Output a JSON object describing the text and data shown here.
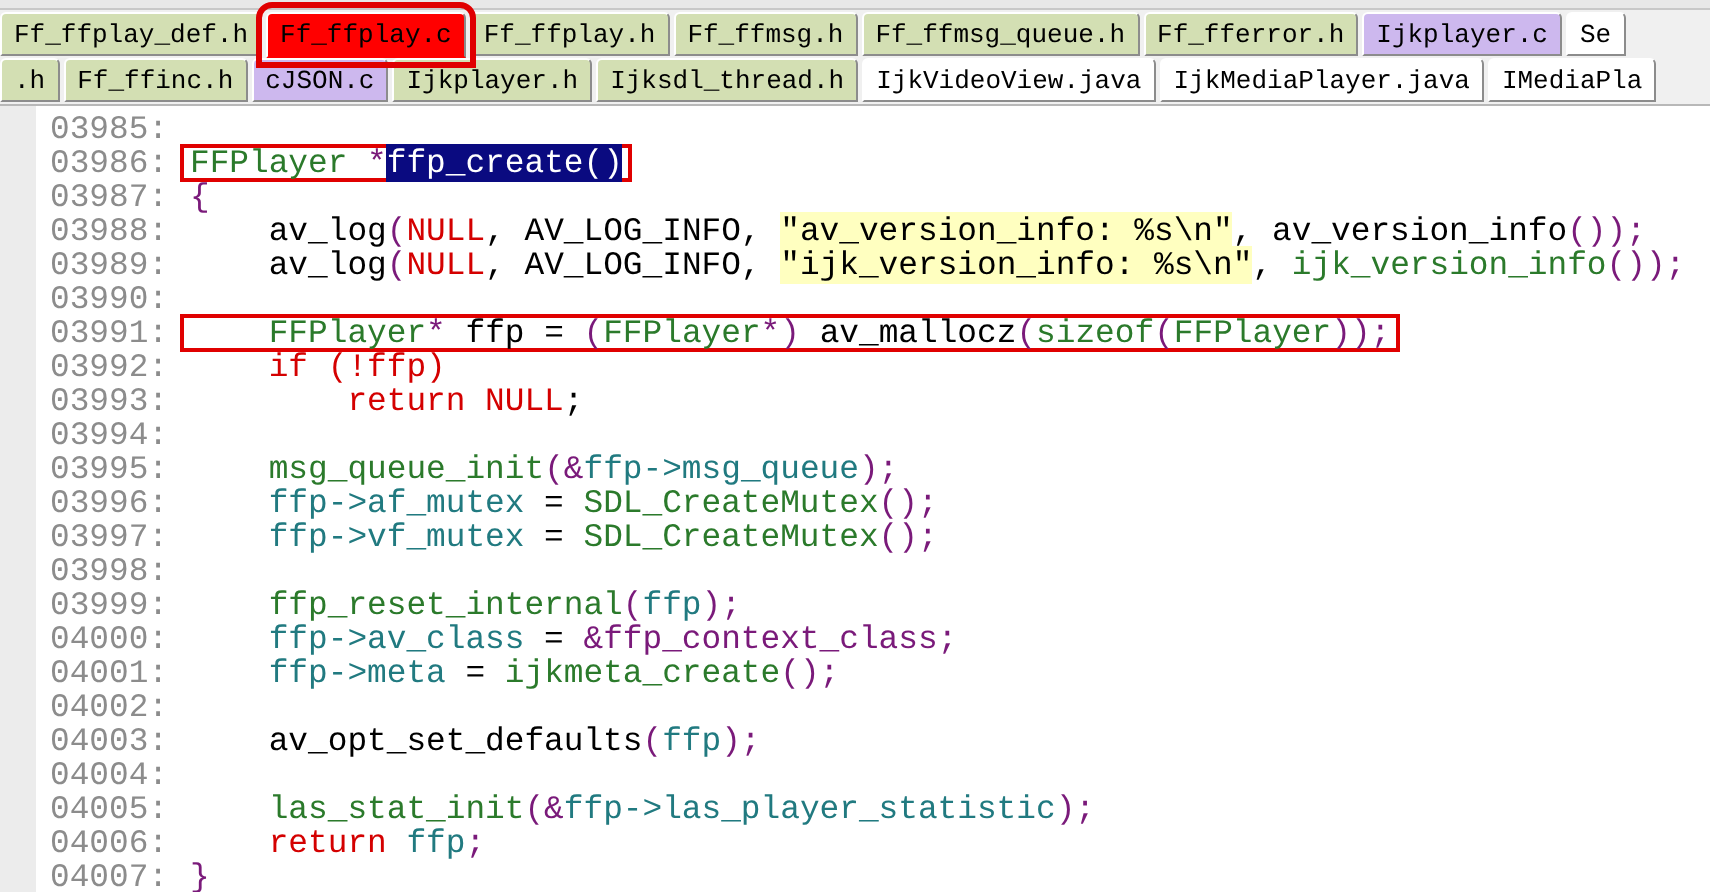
{
  "tab_rows": [
    {
      "tabs": [
        {
          "label": "Ff_ffplay_def.h",
          "color": "#d3dfb3",
          "selected": false,
          "annotated": false
        },
        {
          "label": "Ff_ffplay.c",
          "color": "#ff0000",
          "selected": true,
          "annotated": true
        },
        {
          "label": "Ff_ffplay.h",
          "color": "#d3dfb3",
          "selected": false,
          "annotated": false
        },
        {
          "label": "Ff_ffmsg.h",
          "color": "#d3dfb3",
          "selected": false,
          "annotated": false
        },
        {
          "label": "Ff_ffmsg_queue.h",
          "color": "#d3dfb3",
          "selected": false,
          "annotated": false
        },
        {
          "label": "Ff_fferror.h",
          "color": "#d3dfb3",
          "selected": false,
          "annotated": false
        },
        {
          "label": "Ijkplayer.c",
          "color": "#cdb8ee",
          "selected": false,
          "annotated": false
        },
        {
          "label": "Se",
          "color": "#ffffff",
          "selected": false,
          "annotated": false
        }
      ]
    },
    {
      "tabs": [
        {
          "label": ".h",
          "color": "#d3dfb3",
          "selected": false,
          "annotated": false
        },
        {
          "label": "Ff_ffinc.h",
          "color": "#d3dfb3",
          "selected": false,
          "annotated": false
        },
        {
          "label": "cJSON.c",
          "color": "#cdb8ee",
          "selected": false,
          "annotated": false
        },
        {
          "label": "Ijkplayer.h",
          "color": "#d3dfb3",
          "selected": false,
          "annotated": false
        },
        {
          "label": "Ijksdl_thread.h",
          "color": "#d3dfb3",
          "selected": false,
          "annotated": false
        },
        {
          "label": "IjkVideoView.java",
          "color": "#ffffff",
          "selected": false,
          "annotated": false
        },
        {
          "label": "IjkMediaPlayer.java",
          "color": "#ffffff",
          "selected": false,
          "annotated": false
        },
        {
          "label": "IMediaPla",
          "color": "#ffffff",
          "selected": false,
          "annotated": false
        }
      ]
    }
  ],
  "code_lines": [
    {
      "number": "03985:"
    },
    {
      "number": "03986:",
      "annotated": true,
      "tokens": [
        {
          "kind": "f",
          "text": "FFPlayer "
        },
        {
          "kind": "p",
          "text": "*"
        },
        {
          "kind": "sel",
          "text": "ffp_create()"
        }
      ]
    },
    {
      "number": "03987:",
      "tokens": [
        {
          "kind": "p",
          "text": "{"
        }
      ]
    },
    {
      "number": "03988:",
      "tokens": [
        {
          "kind": "t",
          "text": "    av_log"
        },
        {
          "kind": "p",
          "text": "("
        },
        {
          "kind": "k",
          "text": "NULL"
        },
        {
          "kind": "t",
          "text": ", AV_LOG_INFO, "
        },
        {
          "kind": "s",
          "text": "\"av_version_info: %s\\n\""
        },
        {
          "kind": "t",
          "text": ", av_version_info"
        },
        {
          "kind": "p",
          "text": "());"
        }
      ]
    },
    {
      "number": "03989:",
      "tokens": [
        {
          "kind": "t",
          "text": "    av_log"
        },
        {
          "kind": "p",
          "text": "("
        },
        {
          "kind": "k",
          "text": "NULL"
        },
        {
          "kind": "t",
          "text": ", AV_LOG_INFO, "
        },
        {
          "kind": "s",
          "text": "\"ijk_version_info: %s\\n\""
        },
        {
          "kind": "t",
          "text": ", "
        },
        {
          "kind": "f",
          "text": "ijk_version_info"
        },
        {
          "kind": "p",
          "text": "());"
        }
      ]
    },
    {
      "number": "03990:"
    },
    {
      "number": "03991:",
      "annotated": true,
      "tokens": [
        {
          "kind": "f",
          "text": "    FFPlayer"
        },
        {
          "kind": "p",
          "text": "*"
        },
        {
          "kind": "t",
          "text": " ffp = "
        },
        {
          "kind": "p",
          "text": "("
        },
        {
          "kind": "f",
          "text": "FFPlayer"
        },
        {
          "kind": "p",
          "text": "*)"
        },
        {
          "kind": "t",
          "text": " av_mallocz"
        },
        {
          "kind": "p",
          "text": "("
        },
        {
          "kind": "f",
          "text": "sizeof"
        },
        {
          "kind": "p",
          "text": "("
        },
        {
          "kind": "f",
          "text": "FFPlayer"
        },
        {
          "kind": "p",
          "text": "));"
        }
      ]
    },
    {
      "number": "03992:",
      "tokens": [
        {
          "kind": "k",
          "text": "    if (!ffp)"
        }
      ]
    },
    {
      "number": "03993:",
      "tokens": [
        {
          "kind": "k",
          "text": "        return NULL"
        },
        {
          "kind": "t",
          "text": ";"
        }
      ]
    },
    {
      "number": "03994:"
    },
    {
      "number": "03995:",
      "tokens": [
        {
          "kind": "f",
          "text": "    msg_queue_init"
        },
        {
          "kind": "p",
          "text": "(&"
        },
        {
          "kind": "v",
          "text": "ffp->msg_queue"
        },
        {
          "kind": "p",
          "text": ");"
        }
      ]
    },
    {
      "number": "03996:",
      "tokens": [
        {
          "kind": "v",
          "text": "    ffp->af_mutex"
        },
        {
          "kind": "t",
          "text": " = "
        },
        {
          "kind": "f",
          "text": "SDL_CreateMutex"
        },
        {
          "kind": "p",
          "text": "();"
        }
      ]
    },
    {
      "number": "03997:",
      "tokens": [
        {
          "kind": "v",
          "text": "    ffp->vf_mutex"
        },
        {
          "kind": "t",
          "text": " = "
        },
        {
          "kind": "f",
          "text": "SDL_CreateMutex"
        },
        {
          "kind": "p",
          "text": "();"
        }
      ]
    },
    {
      "number": "03998:"
    },
    {
      "number": "03999:",
      "tokens": [
        {
          "kind": "f",
          "text": "    ffp_reset_internal"
        },
        {
          "kind": "p",
          "text": "("
        },
        {
          "kind": "v",
          "text": "ffp"
        },
        {
          "kind": "p",
          "text": ");"
        }
      ]
    },
    {
      "number": "04000:",
      "tokens": [
        {
          "kind": "v",
          "text": "    ffp->av_class"
        },
        {
          "kind": "t",
          "text": " = "
        },
        {
          "kind": "p",
          "text": "&ffp_context_class;"
        }
      ]
    },
    {
      "number": "04001:",
      "tokens": [
        {
          "kind": "v",
          "text": "    ffp->meta"
        },
        {
          "kind": "t",
          "text": " = "
        },
        {
          "kind": "f",
          "text": "ijkmeta_create"
        },
        {
          "kind": "p",
          "text": "();"
        }
      ]
    },
    {
      "number": "04002:"
    },
    {
      "number": "04003:",
      "tokens": [
        {
          "kind": "t",
          "text": "    av_opt_set_defaults"
        },
        {
          "kind": "p",
          "text": "("
        },
        {
          "kind": "v",
          "text": "ffp"
        },
        {
          "kind": "p",
          "text": ");"
        }
      ]
    },
    {
      "number": "04004:"
    },
    {
      "number": "04005:",
      "tokens": [
        {
          "kind": "f",
          "text": "    las_stat_init"
        },
        {
          "kind": "p",
          "text": "(&"
        },
        {
          "kind": "v",
          "text": "ffp->las_player_statistic"
        },
        {
          "kind": "p",
          "text": ");"
        }
      ]
    },
    {
      "number": "04006:",
      "tokens": [
        {
          "kind": "k",
          "text": "    return "
        },
        {
          "kind": "v",
          "text": "ffp"
        },
        {
          "kind": "p",
          "text": ";"
        }
      ]
    },
    {
      "number": "04007:",
      "tokens": [
        {
          "kind": "p",
          "text": "}"
        }
      ]
    }
  ]
}
